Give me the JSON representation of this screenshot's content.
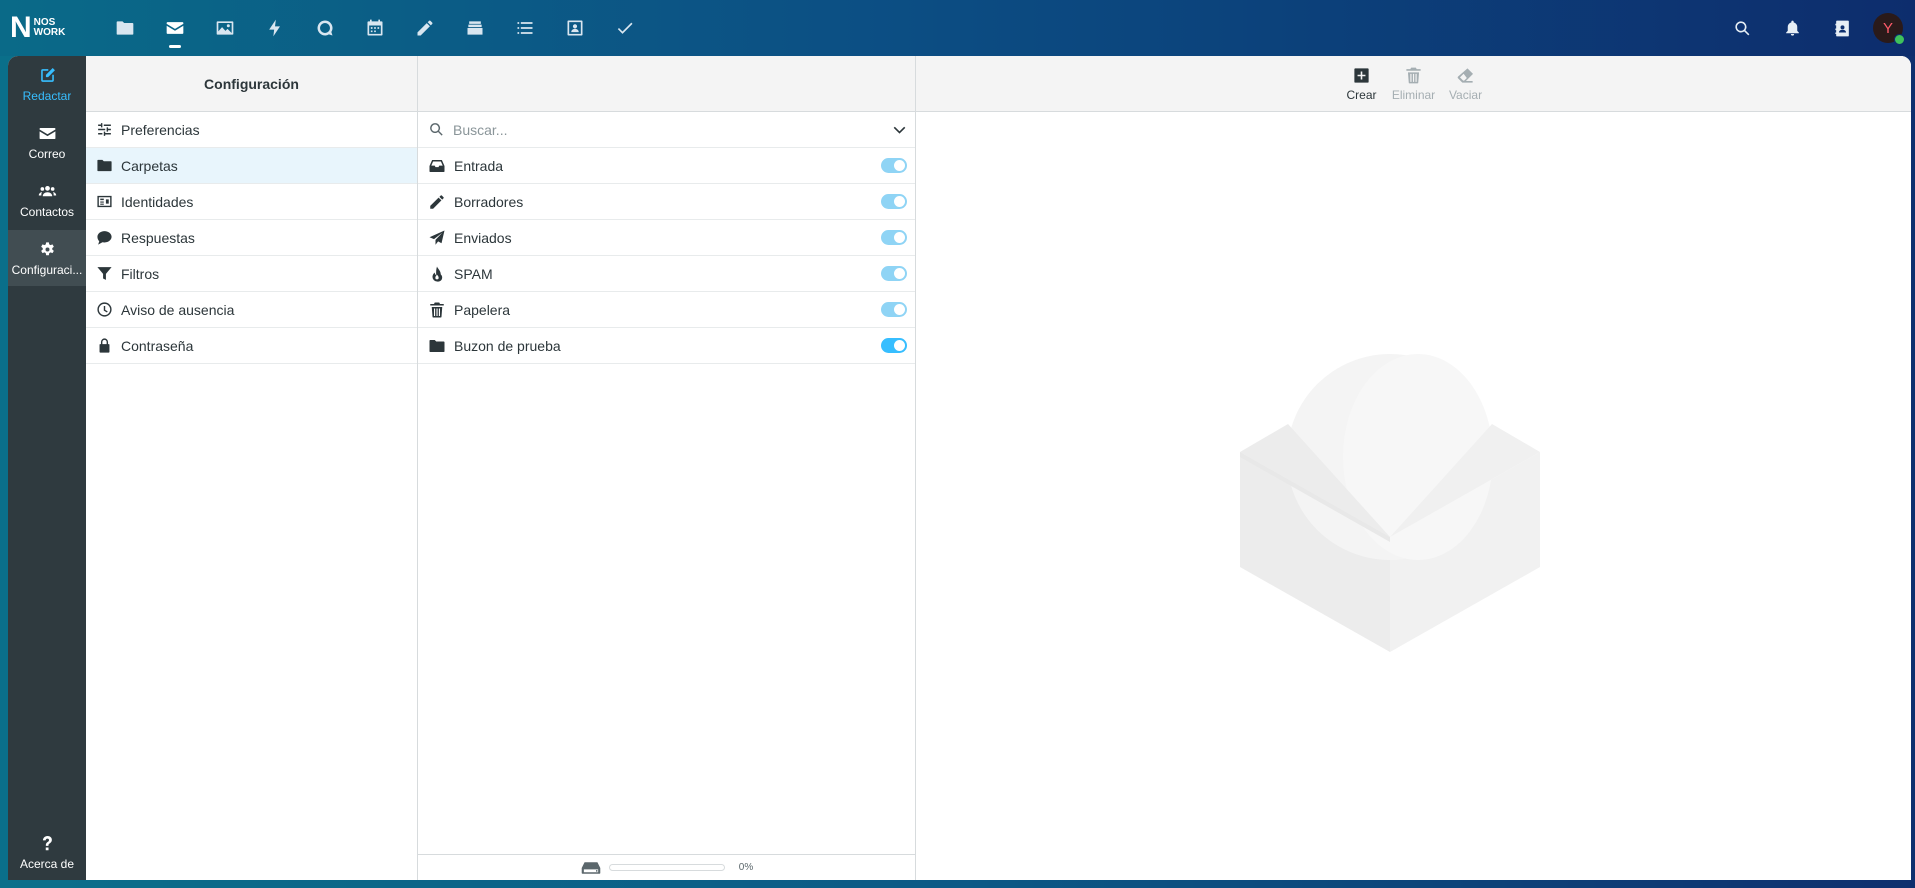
{
  "topbar": {
    "logo": {
      "letter": "N",
      "line1": "NOS",
      "line2": "WORK",
      "tagline": ""
    },
    "apps": [
      {
        "name": "files",
        "icon": "folder-icon"
      },
      {
        "name": "mail",
        "icon": "envelope-icon",
        "active": true
      },
      {
        "name": "photos",
        "icon": "image-icon"
      },
      {
        "name": "activity",
        "icon": "bolt-icon"
      },
      {
        "name": "talk",
        "icon": "chat-icon"
      },
      {
        "name": "calendar",
        "icon": "calendar-icon"
      },
      {
        "name": "notes",
        "icon": "pencil-icon"
      },
      {
        "name": "deck",
        "icon": "stack-icon"
      },
      {
        "name": "tasks-list",
        "icon": "list-icon"
      },
      {
        "name": "contacts-app",
        "icon": "contact-card-icon"
      },
      {
        "name": "tasks",
        "icon": "check-icon"
      }
    ],
    "avatar_letter": "Y"
  },
  "leftnav": {
    "compose": "Redactar",
    "mail": "Correo",
    "contacts": "Contactos",
    "settings": "Configuraci...",
    "about": "Acerca de"
  },
  "settings": {
    "title": "Configuración",
    "items": [
      {
        "label": "Preferencias",
        "icon": "sliders-icon"
      },
      {
        "label": "Carpetas",
        "icon": "folder-icon",
        "selected": true
      },
      {
        "label": "Identidades",
        "icon": "id-card-icon"
      },
      {
        "label": "Respuestas",
        "icon": "comment-icon"
      },
      {
        "label": "Filtros",
        "icon": "filter-icon"
      },
      {
        "label": "Aviso de ausencia",
        "icon": "clock-icon"
      },
      {
        "label": "Contraseña",
        "icon": "lock-icon"
      }
    ]
  },
  "folders": {
    "search_placeholder": "Buscar...",
    "items": [
      {
        "label": "Entrada",
        "icon": "inbox-icon",
        "subscribed": true,
        "locked": true
      },
      {
        "label": "Borradores",
        "icon": "pencil-icon",
        "subscribed": true,
        "locked": true
      },
      {
        "label": "Enviados",
        "icon": "paper-plane-icon",
        "subscribed": true,
        "locked": true
      },
      {
        "label": "SPAM",
        "icon": "fire-icon",
        "subscribed": true,
        "locked": true
      },
      {
        "label": "Papelera",
        "icon": "trash-icon",
        "subscribed": true,
        "locked": true
      },
      {
        "label": "Buzon de prueba",
        "icon": "folder-icon",
        "subscribed": true,
        "locked": false
      }
    ],
    "quota_percent": "0%",
    "quota_value": 0
  },
  "toolbar": {
    "create": "Crear",
    "delete": "Eliminar",
    "empty": "Vaciar"
  },
  "colors": {
    "accent": "#37beff",
    "toggle_on": "#37beff",
    "toggle_locked": "#8fd4f5",
    "nav_bg": "#2f3a3f"
  }
}
